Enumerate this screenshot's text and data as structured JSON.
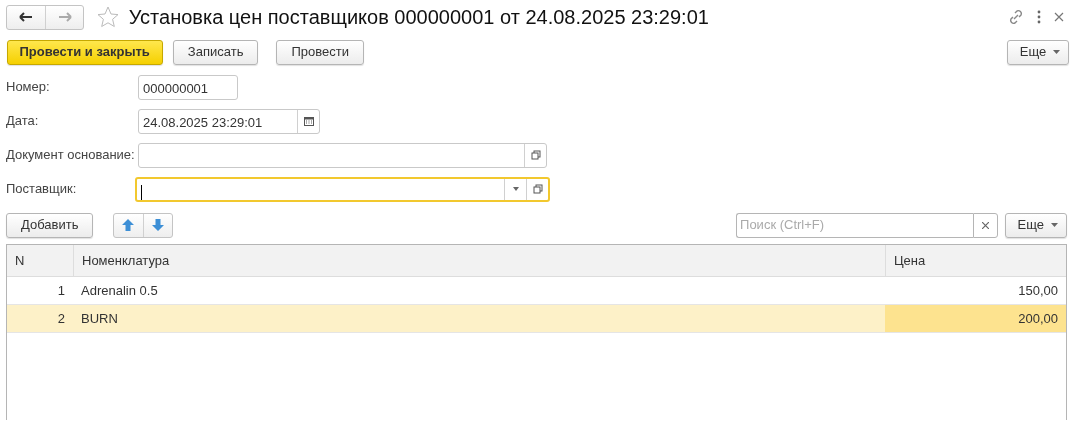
{
  "window": {
    "title": "Установка цен поставщиков 000000001 от 24.08.2025 23:29:01",
    "favorite": false
  },
  "command_bar": {
    "buttons": [
      {
        "label": "Провести и закрыть",
        "kind": "primary"
      },
      {
        "label": "Записать",
        "kind": "default"
      },
      {
        "label": "Провести",
        "kind": "default"
      }
    ],
    "more": "Еще"
  },
  "fields": [
    {
      "label": "Номер:",
      "value": "000000001",
      "kind": "text",
      "focused": false
    },
    {
      "label": "Дата:",
      "value": "24.08.2025 23:29:01",
      "kind": "date",
      "focused": false
    },
    {
      "label": "Документ основание:",
      "kind": "link",
      "focused": false
    },
    {
      "label": "Поставщик:",
      "kind": "select",
      "focused": true
    }
  ],
  "table_toolbar": {
    "add": "Добавить",
    "search": {
      "placeholder": "Поиск (Ctrl+F)"
    },
    "more": "Еще"
  },
  "table": {
    "columns": [
      "N",
      "Номенклатура",
      "Цена"
    ],
    "rows": [
      {
        "cells": [
          "1",
          "Adrenalin 0.5",
          "150,00"
        ],
        "selected": false
      },
      {
        "cells": [
          "2",
          "BURN",
          "200,00"
        ],
        "selected": true
      }
    ]
  }
}
